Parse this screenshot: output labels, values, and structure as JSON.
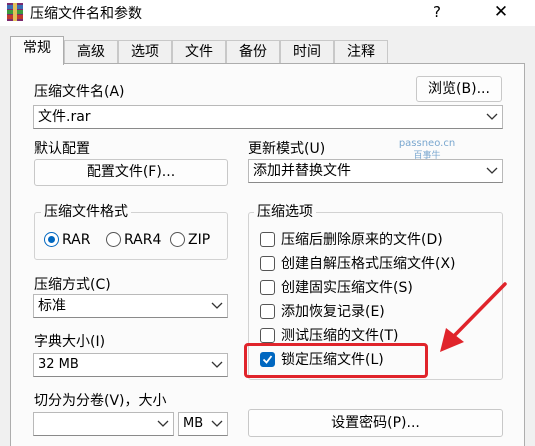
{
  "window": {
    "title": "压缩文件名和参数",
    "help_glyph": "?",
    "close_glyph": "✕"
  },
  "tabs": [
    "常规",
    "高级",
    "选项",
    "文件",
    "备份",
    "时间",
    "注释"
  ],
  "archive_name": {
    "label": "压缩文件名(A)",
    "browse_label": "浏览(B)...",
    "value": "文件.rar"
  },
  "default_profile": {
    "label": "默认配置",
    "button_label": "配置文件(F)..."
  },
  "update_mode": {
    "label": "更新模式(U)",
    "value": "添加并替换文件"
  },
  "format": {
    "group_title": "压缩文件格式",
    "options": [
      "RAR",
      "RAR4",
      "ZIP"
    ],
    "selected": "RAR"
  },
  "compression_method": {
    "label": "压缩方式(C)",
    "value": "标准"
  },
  "dictionary_size": {
    "label": "字典大小(I)",
    "value": "32 MB"
  },
  "split_volumes": {
    "label": "切分为分卷(V)，大小",
    "value": "",
    "unit": "MB"
  },
  "compression_options": {
    "group_title": "压缩选项",
    "items": [
      {
        "label": "压缩后删除原来的文件(D)",
        "checked": false
      },
      {
        "label": "创建自解压格式压缩文件(X)",
        "checked": false
      },
      {
        "label": "创建固实压缩文件(S)",
        "checked": false
      },
      {
        "label": "添加恢复记录(E)",
        "checked": false
      },
      {
        "label": "测试压缩的文件(T)",
        "checked": false
      },
      {
        "label": "锁定压缩文件(L)",
        "checked": true
      }
    ]
  },
  "set_password_label": "设置密码(P)...",
  "watermark": {
    "line1": "passneo.cn",
    "line2": "百事牛"
  },
  "colors": {
    "accent": "#0067c0",
    "annotation": "#e0242b"
  }
}
